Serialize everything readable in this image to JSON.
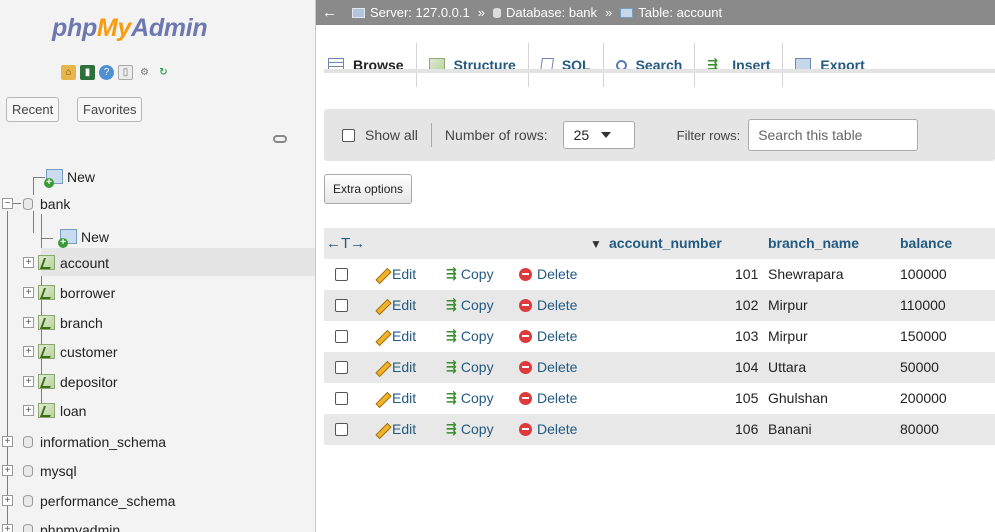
{
  "nav": {
    "logo": {
      "php": "php",
      "my": "My",
      "admin": "Admin"
    },
    "tabs": {
      "recent": "Recent",
      "favorites": "Favorites"
    },
    "tree": {
      "new_top": "New",
      "bank": "bank",
      "bank_new": "New",
      "tables": [
        "account",
        "borrower",
        "branch",
        "customer",
        "depositor",
        "loan"
      ],
      "databases": [
        "information_schema",
        "mysql",
        "performance_schema",
        "phpmyadmin"
      ]
    }
  },
  "breadcrumb": {
    "server": "Server: 127.0.0.1",
    "database": "Database: bank",
    "table": "Table: account",
    "separator": "»"
  },
  "tabs": [
    "Browse",
    "Structure",
    "SQL",
    "Search",
    "Insert",
    "Export"
  ],
  "filter": {
    "show_all": "Show all",
    "rows_label": "Number of rows:",
    "rows_value": "25",
    "filter_label": "Filter rows:",
    "search_placeholder": "Search this table"
  },
  "extra_options": "Extra options",
  "table": {
    "arrows": "←T→",
    "sort_icon": "▼",
    "columns": [
      "account_number",
      "branch_name",
      "balance"
    ],
    "actions": {
      "edit": "Edit",
      "copy": "Copy",
      "delete": "Delete"
    },
    "rows": [
      {
        "account_number": "101",
        "branch_name": "Shewrapara",
        "balance": "100000"
      },
      {
        "account_number": "102",
        "branch_name": "Mirpur",
        "balance": "110000"
      },
      {
        "account_number": "103",
        "branch_name": "Mirpur",
        "balance": "150000"
      },
      {
        "account_number": "104",
        "branch_name": "Uttara",
        "balance": "50000"
      },
      {
        "account_number": "105",
        "branch_name": "Ghulshan",
        "balance": "200000"
      },
      {
        "account_number": "106",
        "branch_name": "Banani",
        "balance": "80000"
      }
    ]
  },
  "colors": {
    "link": "#235a81",
    "crumb_bg": "#8a8a8a",
    "logo_blue": "#6c78af",
    "logo_orange": "#f89c0e"
  }
}
